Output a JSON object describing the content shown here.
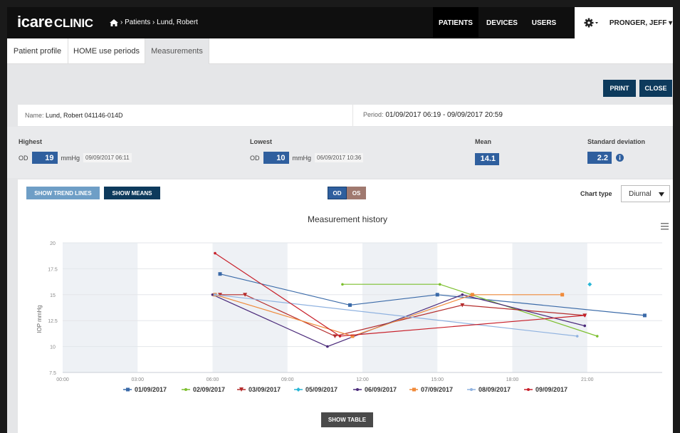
{
  "app": {
    "logo_main": "icare",
    "logo_sub": "CLINIC"
  },
  "breadcrumb": {
    "text": "› Patients › Lund, Robert"
  },
  "nav": {
    "patients": "PATIENTS",
    "devices": "DEVICES",
    "users": "USERS",
    "user": "PRONGER, JEFF ▾"
  },
  "tabs": {
    "profile": "Patient profile",
    "home": "HOME use periods",
    "measurements": "Measurements"
  },
  "actions": {
    "print": "PRINT",
    "close": "CLOSE"
  },
  "info": {
    "name_label": "Name:",
    "name_value": "Lund, Robert 041146-014D",
    "period_label": "Period:",
    "period_value": "01/09/2017 06:19 - 09/09/2017 20:59"
  },
  "stats": {
    "highest_label": "Highest",
    "highest_eye": "OD",
    "highest_value": "19",
    "highest_unit": "mmHg",
    "highest_date": "09/09/2017 06:11",
    "lowest_label": "Lowest",
    "lowest_eye": "OD",
    "lowest_value": "10",
    "lowest_unit": "mmHg",
    "lowest_date": "06/09/2017 10:36",
    "mean_label": "Mean",
    "mean_value": "14.1",
    "sd_label": "Standard deviation",
    "sd_value": "2.2"
  },
  "controls": {
    "trend": "SHOW TREND LINES",
    "means": "SHOW MEANS",
    "od": "OD",
    "os": "OS",
    "chart_type_label": "Chart type",
    "chart_type_value": "Diurnal",
    "show_table": "SHOW TABLE"
  },
  "chart_data": {
    "type": "line",
    "title": "Measurement history",
    "ylabel": "IOP mmHg",
    "xlabel": "",
    "x_ticks": [
      "00:00",
      "03:00",
      "06:00",
      "09:00",
      "12:00",
      "15:00",
      "18:00",
      "21:00"
    ],
    "y_ticks": [
      "7.5",
      "10",
      "12.5",
      "15",
      "17.5",
      "20"
    ],
    "ylim": [
      7.5,
      20
    ],
    "xlim_hours": [
      0,
      24
    ],
    "grid": true,
    "legend_position": "bottom",
    "series": [
      {
        "name": "01/09/2017",
        "color": "#3a6aa8",
        "marker": "square",
        "points": [
          [
            6.3,
            17
          ],
          [
            11.5,
            14
          ],
          [
            15,
            15
          ],
          [
            23.3,
            13
          ]
        ]
      },
      {
        "name": "02/09/2017",
        "color": "#7cbf2e",
        "marker": "line",
        "points": [
          [
            11.2,
            16
          ],
          [
            15.1,
            16
          ],
          [
            21.4,
            11
          ]
        ]
      },
      {
        "name": "03/09/2017",
        "color": "#b52c2c",
        "marker": "triangle-down",
        "points": [
          [
            6.3,
            15
          ],
          [
            7.3,
            15
          ],
          [
            10.9,
            11
          ],
          [
            16,
            14
          ],
          [
            20.9,
            13
          ]
        ]
      },
      {
        "name": "05/09/2017",
        "color": "#29b6d6",
        "marker": "diamond",
        "points": [
          [
            21.1,
            16
          ]
        ]
      },
      {
        "name": "06/09/2017",
        "color": "#4b2a7a",
        "marker": "line",
        "points": [
          [
            6,
            15
          ],
          [
            10.6,
            10
          ],
          [
            16,
            15
          ],
          [
            20.9,
            12
          ]
        ]
      },
      {
        "name": "07/09/2017",
        "color": "#f08a3a",
        "marker": "square",
        "points": [
          [
            6.1,
            15
          ],
          [
            11.6,
            11
          ],
          [
            16.4,
            15
          ],
          [
            20.0,
            15
          ]
        ]
      },
      {
        "name": "08/09/2017",
        "color": "#8fb2e0",
        "marker": "line",
        "points": [
          [
            6.1,
            15
          ],
          [
            20.6,
            11
          ]
        ]
      },
      {
        "name": "09/09/2017",
        "color": "#c8202a",
        "marker": "line",
        "points": [
          [
            6.1,
            19
          ],
          [
            11.1,
            11
          ],
          [
            20.9,
            13
          ]
        ]
      }
    ]
  }
}
